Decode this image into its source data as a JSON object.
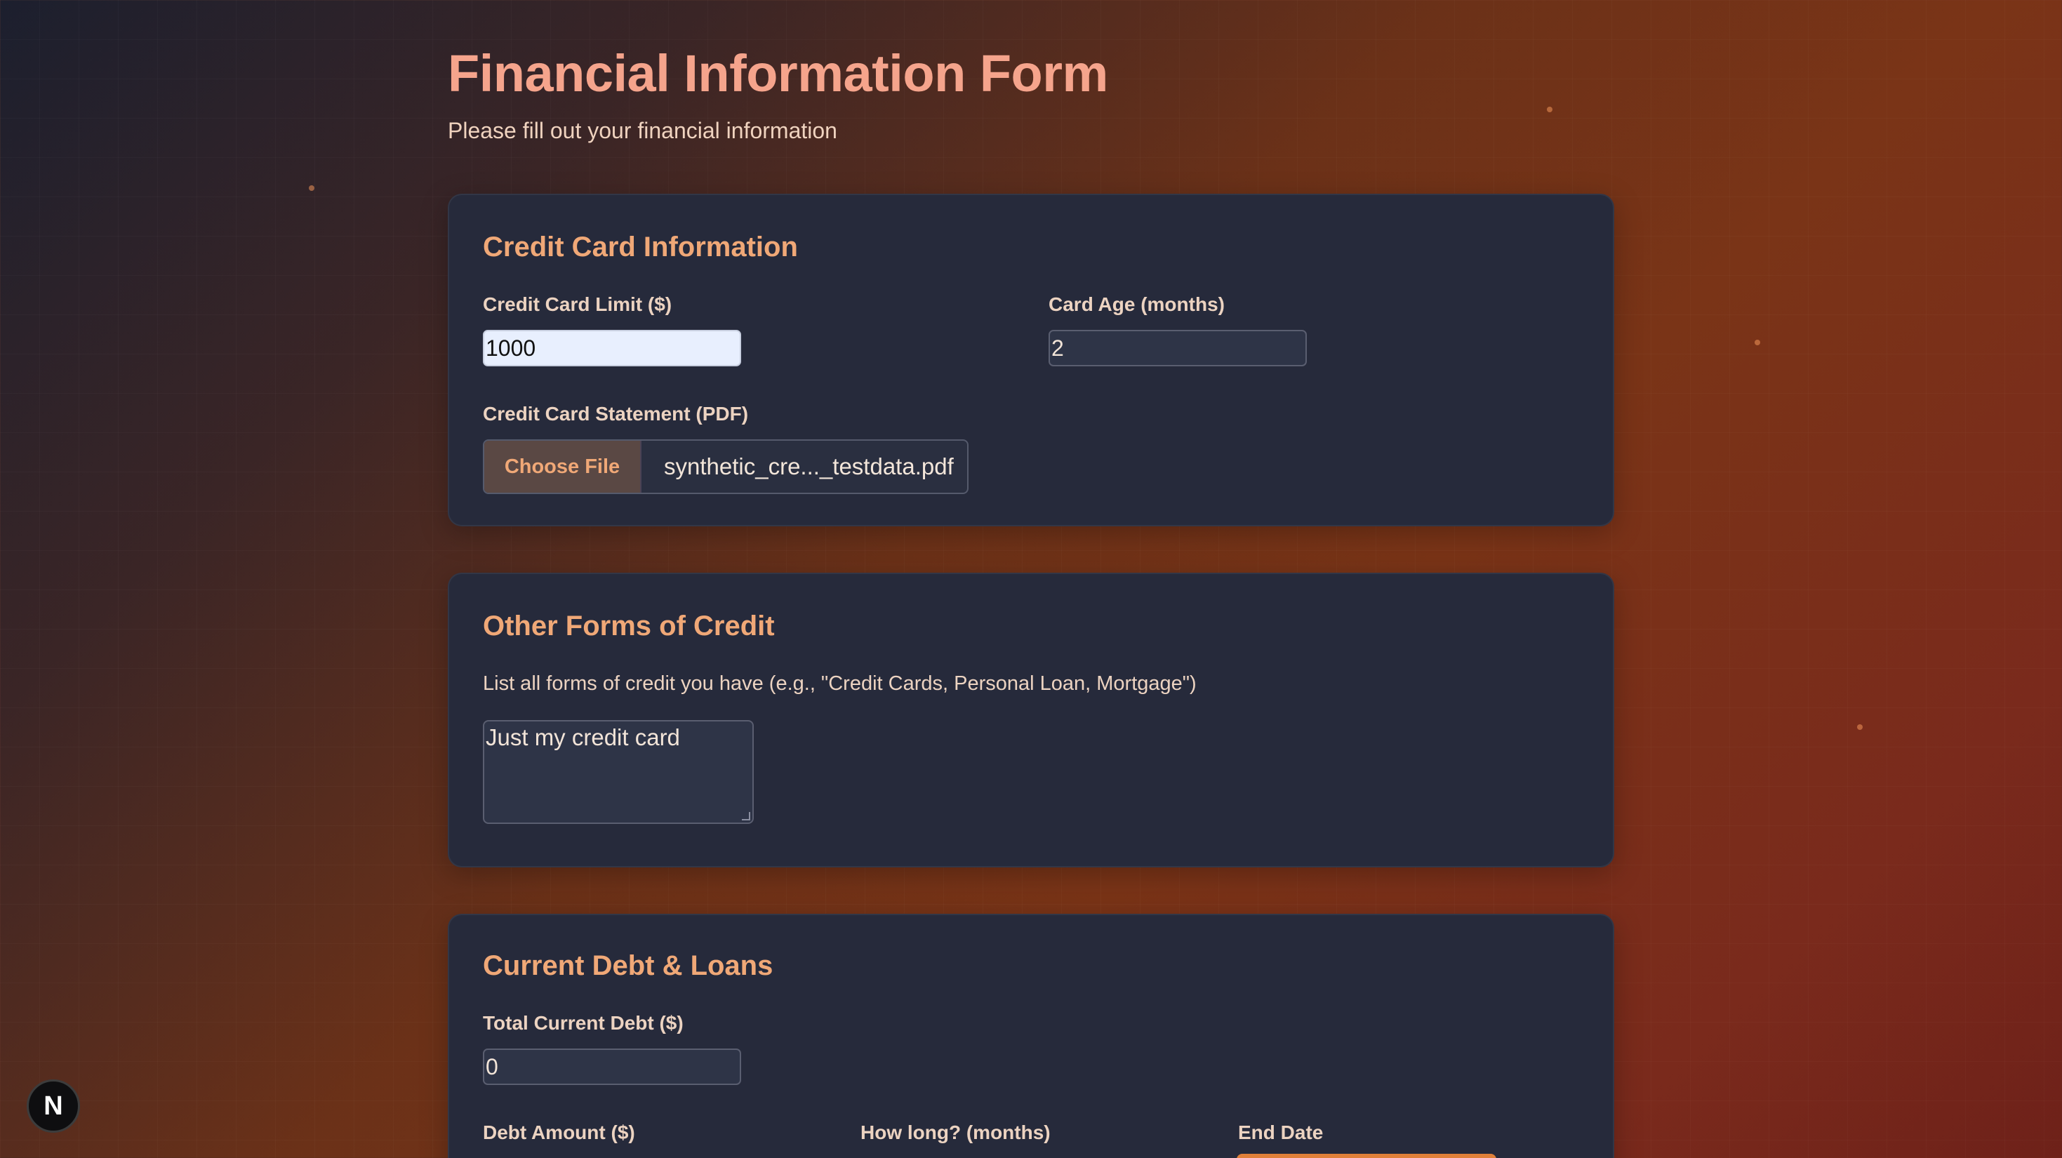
{
  "header": {
    "title": "Financial Information Form",
    "subtitle": "Please fill out your financial information"
  },
  "credit_card": {
    "section_title": "Credit Card Information",
    "limit_label": "Credit Card Limit ($)",
    "limit_value": "1000",
    "age_label": "Card Age (months)",
    "age_value": "2",
    "statement_label": "Credit Card Statement (PDF)",
    "choose_file_label": "Choose File",
    "file_name": "synthetic_cre..._testdata.pdf"
  },
  "other_credit": {
    "section_title": "Other Forms of Credit",
    "hint": "List all forms of credit you have (e.g., \"Credit Cards, Personal Loan, Mortgage\")",
    "value": "Just my credit card"
  },
  "debt": {
    "section_title": "Current Debt & Loans",
    "total_label": "Total Current Debt ($)",
    "total_value": "0",
    "debt_amount_label": "Debt Amount ($)",
    "how_long_label": "How long? (months)",
    "end_date_label": "End Date"
  },
  "dev_badge": {
    "label": "N"
  },
  "colors": {
    "title": "#f5a48c",
    "section_title": "#f0a877",
    "card_bg": "#262a3b",
    "accent": "#e0803a"
  }
}
